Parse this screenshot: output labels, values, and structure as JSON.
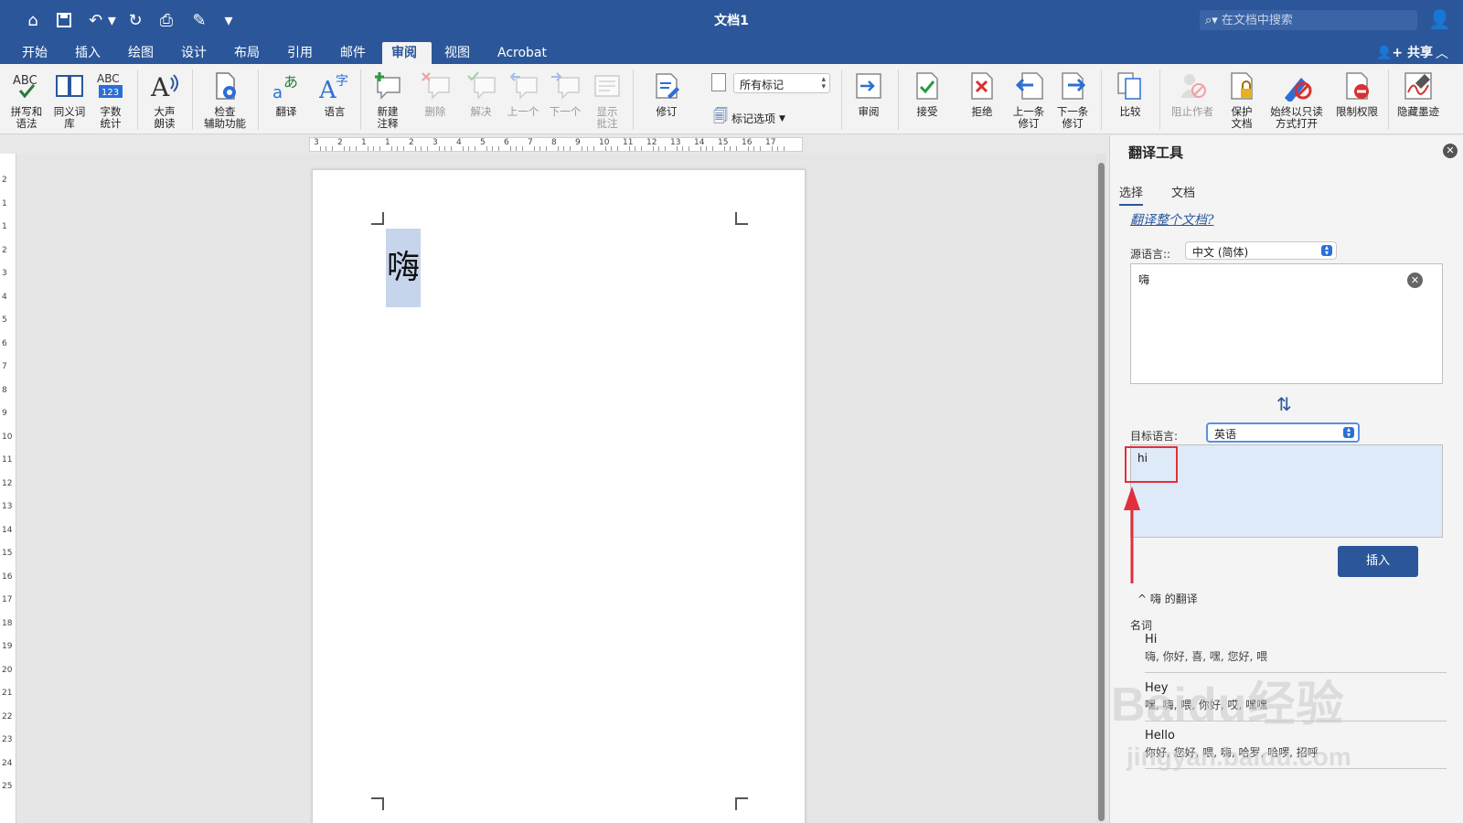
{
  "window": {
    "title": "文档1"
  },
  "search": {
    "placeholder": "在文档中搜索"
  },
  "tabs": [
    "开始",
    "插入",
    "绘图",
    "设计",
    "布局",
    "引用",
    "邮件",
    "审阅",
    "视图",
    "Acrobat"
  ],
  "active_tab": "审阅",
  "share_label": "共享",
  "ribbon": {
    "spelling": "拼写和\n语法",
    "thesaurus": "同义词\n库",
    "wordcount": "字数\n统计",
    "readaloud": "大声\n朗读",
    "accessibility": "检查\n辅助功能",
    "translate": "翻译",
    "language": "语言",
    "new_comment": "新建\n注释",
    "delete": "删除",
    "resolve": "解决",
    "previous": "上一个",
    "next": "下一个",
    "show_comments": "显示\n批注",
    "track_changes": "修订",
    "markup_view": "所有标记",
    "markup_options": "标记选项",
    "reviewing_pane": "审阅",
    "accept": "接受",
    "reject": "拒绝",
    "prev_change": "上一条\n修订",
    "next_change": "下一条\n修订",
    "compare": "比较",
    "block_authors": "阻止作者",
    "protect_doc": "保护\n文档",
    "always_readonly": "始终以只读\n方式打开",
    "restrict_permission": "限制权限",
    "hide_ink": "隐藏墨迹"
  },
  "ruler": {
    "h_labels": [
      "3",
      "2",
      "1",
      "1",
      "2",
      "3",
      "4",
      "5",
      "6",
      "7",
      "8",
      "9",
      "10",
      "11",
      "12",
      "13",
      "14",
      "15",
      "16",
      "17"
    ],
    "v_labels": [
      "2",
      "1",
      "1",
      "2",
      "3",
      "4",
      "5",
      "6",
      "7",
      "8",
      "9",
      "10",
      "11",
      "12",
      "13",
      "14",
      "15",
      "16",
      "17",
      "18",
      "19",
      "20",
      "21",
      "22",
      "23",
      "24",
      "25"
    ]
  },
  "document": {
    "text": "嗨"
  },
  "pane": {
    "title": "翻译工具",
    "tab_selection": "选择",
    "tab_document": "文档",
    "translate_doc_link": "翻译整个文档?",
    "source_label": "源语言::",
    "source_lang": "中文 (简体)",
    "source_text": "嗨",
    "target_label": "目标语言:",
    "target_lang": "英语",
    "target_text": "hi",
    "insert_label": "插入",
    "translations_of": "嗨 的翻译",
    "part_of_speech": "名词",
    "entries": [
      {
        "word": "Hi",
        "synonyms": "嗨, 你好, 喜, 嘿, 您好, 喂"
      },
      {
        "word": "Hey",
        "synonyms": "嘿, 嗨, 喂, 你好, 哎, 嘿嘿"
      },
      {
        "word": "Hello",
        "synonyms": "你好, 您好, 喂, 嗨, 哈罗, 哈啰, 招呼"
      }
    ]
  },
  "watermark": {
    "line1": "Baidu经验",
    "line2": "jingyan.baidu.com"
  },
  "colors": {
    "brand": "#2b579a",
    "highlight": "#c6d4ec",
    "annotation": "#e0303b"
  }
}
